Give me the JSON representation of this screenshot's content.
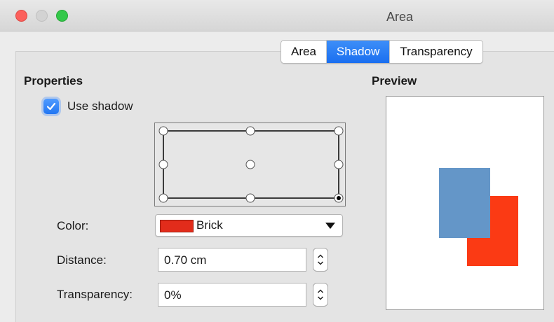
{
  "window": {
    "title": "Area"
  },
  "tabs": [
    {
      "label": "Area",
      "active": false
    },
    {
      "label": "Shadow",
      "active": true
    },
    {
      "label": "Transparency",
      "active": false
    }
  ],
  "properties": {
    "title": "Properties",
    "use_shadow": {
      "label": "Use shadow",
      "checked": true
    },
    "color": {
      "label": "Color:",
      "value": "Brick",
      "swatch": "#e22c1b"
    },
    "distance": {
      "label": "Distance:",
      "value": "0.70 cm"
    },
    "transparency": {
      "label": "Transparency:",
      "value": "0%"
    },
    "position_selected": "bottom-right"
  },
  "preview": {
    "title": "Preview",
    "object_color": "#6496c8",
    "shadow_color": "#fb3a14"
  }
}
